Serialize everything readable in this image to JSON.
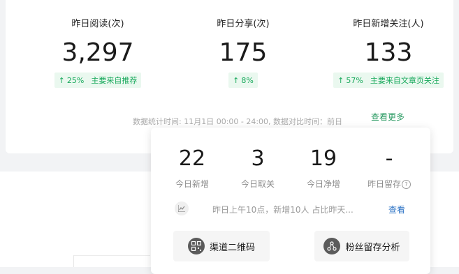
{
  "metrics": [
    {
      "label": "昨日阅读(次)",
      "value": "3,297",
      "change": "25%",
      "source": "主要来自推荐"
    },
    {
      "label": "昨日分享(次)",
      "value": "175",
      "change": "8%",
      "source": ""
    },
    {
      "label": "昨日新增关注(人)",
      "value": "133",
      "change": "57%",
      "source": "主要来自文章页关注"
    }
  ],
  "stat_note": "数据统计时间: 11月1日 00:00 - 24:00, 数据对比时间：前日",
  "see_more": "查看更多",
  "popover": {
    "stats": [
      {
        "value": "22",
        "label": "今日新增"
      },
      {
        "value": "3",
        "label": "今日取关"
      },
      {
        "value": "19",
        "label": "今日净增"
      },
      {
        "value": "-",
        "label": "昨日留存"
      }
    ],
    "insight_text": "昨日上午10点，新增10人 占比昨天...",
    "insight_link": "查看",
    "buttons": [
      {
        "label": "渠道二维码",
        "icon": "qrcode-icon"
      },
      {
        "label": "粉丝留存分析",
        "icon": "analysis-icon"
      }
    ]
  },
  "colors": {
    "accent_green": "#19a95c",
    "tag_bg": "#eaf8ef",
    "link_blue": "#2b72c4"
  }
}
